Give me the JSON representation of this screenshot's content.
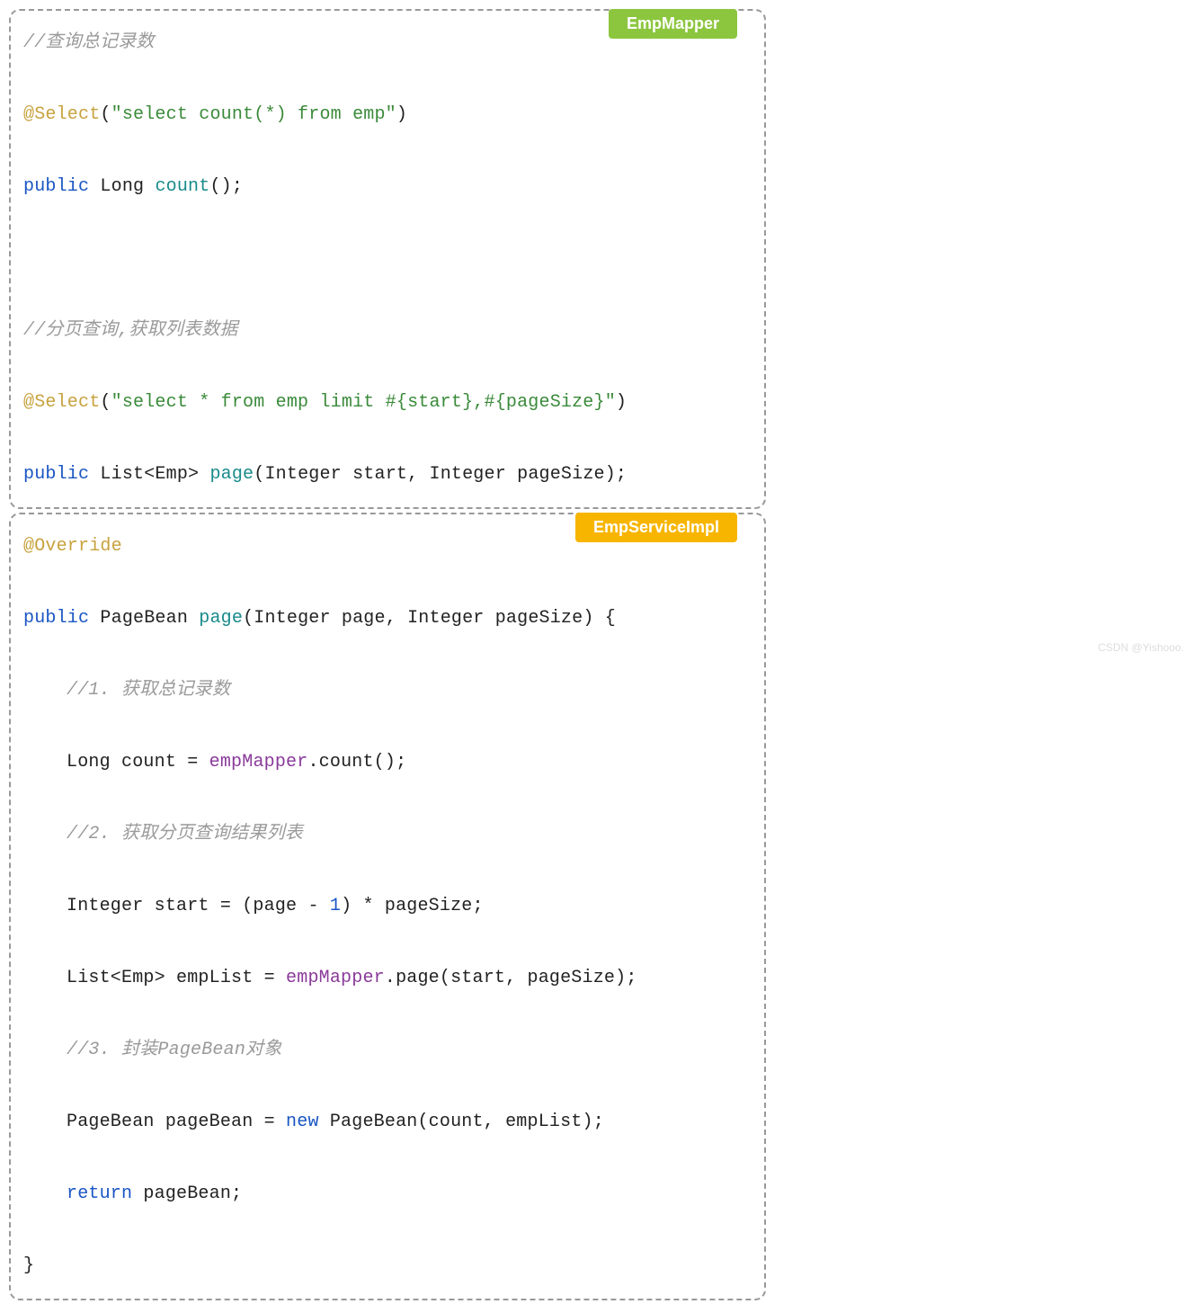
{
  "box1": {
    "label": "EmpMapper",
    "c1": "//查询总记录数",
    "a1_at": "@Select",
    "a1_open": "(",
    "a1_str": "\"select count(*) from emp\"",
    "a1_close": ")",
    "l2_kw1": "public",
    "l2_type": " Long ",
    "l2_fn": "count",
    "l2_rest": "();",
    "c2": "//分页查询,获取列表数据",
    "a2_at": "@Select",
    "a2_open": "(",
    "a2_str": "\"select * from emp limit #{start},#{pageSize}\"",
    "a2_close": ")",
    "l4_kw1": "public",
    "l4_type": " List<Emp> ",
    "l4_fn": "page",
    "l4_rest": "(Integer start, Integer pageSize);"
  },
  "box2": {
    "label": "EmpServiceImpl",
    "a3_at": "@Override",
    "l1_kw": "public",
    "l1_type": " PageBean ",
    "l1_fn": "page",
    "l1_rest": "(Integer page, Integer pageSize) {",
    "c3": "//1. 获取总记录数",
    "l2_a": "Long count = ",
    "l2_fld": "empMapper",
    "l2_b": ".count();",
    "c4": "//2. 获取分页查询结果列表",
    "l3_a": "Integer start = (page - ",
    "l3_num": "1",
    "l3_b": ") * pageSize;",
    "l4_a": "List<Emp> empList = ",
    "l4_fld": "empMapper",
    "l4_b": ".page(start, pageSize);",
    "c5": "//3. 封装PageBean对象",
    "l5_a": "PageBean pageBean = ",
    "l5_kw": "new",
    "l5_b": " PageBean(count, empList);",
    "l6_kw": "return",
    "l6_a": " pageBean;",
    "close": "}"
  },
  "watermark": "CSDN @Yishooo."
}
